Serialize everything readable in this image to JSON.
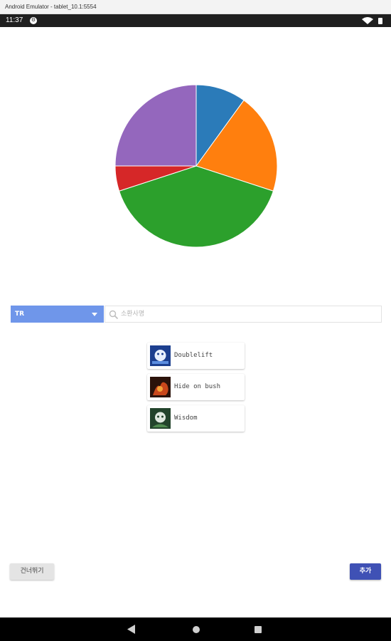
{
  "window": {
    "title": "Android Emulator - tablet_10.1:5554"
  },
  "status_bar": {
    "time": "11:37",
    "notification_icon": "gear-badge-icon",
    "icons": [
      "wifi-icon",
      "battery-icon"
    ]
  },
  "chart_data": {
    "type": "pie",
    "title": "",
    "categories": [
      "blue",
      "orange",
      "green",
      "red",
      "purple"
    ],
    "values": [
      10,
      20,
      40,
      5,
      25
    ],
    "colors": [
      "#2b7bb9",
      "#ff7f0e",
      "#2ca02c",
      "#d62728",
      "#9467bd"
    ],
    "start_angle_deg": 0,
    "legend": "none"
  },
  "region_select": {
    "selected": "TR",
    "icon": "dropdown-caret-icon"
  },
  "search": {
    "placeholder": "소환사명",
    "value": "",
    "icon": "search-icon"
  },
  "players": [
    {
      "name": "Doublelift",
      "avatar": "avatar-icon-blue"
    },
    {
      "name": "Hide on bush",
      "avatar": "avatar-icon-flame"
    },
    {
      "name": "Wisdom",
      "avatar": "avatar-icon-green"
    }
  ],
  "actions": {
    "skip_label": "건너뛰기",
    "add_label": "추가",
    "add_color": "#3f51b5"
  },
  "nav": {
    "back": "back-icon",
    "home": "home-icon",
    "recents": "recents-icon"
  }
}
